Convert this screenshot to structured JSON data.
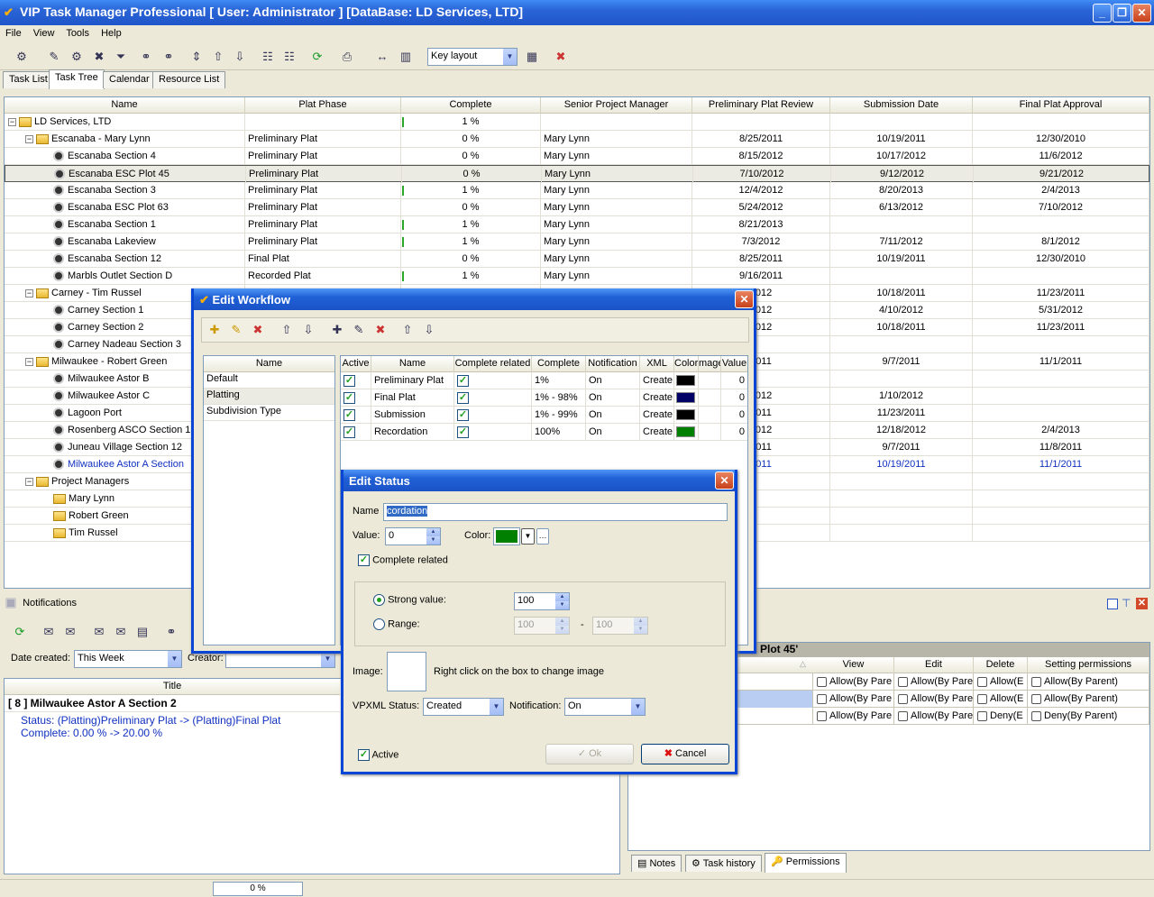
{
  "window": {
    "title": "VIP Task Manager Professional [ User: Administrator ] [DataBase: LD Services, LTD]"
  },
  "menu": [
    "File",
    "View",
    "Tools",
    "Help"
  ],
  "toolbar": {
    "layout_combo": "Key layout"
  },
  "tabs": [
    "Task List",
    "Task Tree",
    "Calendar",
    "Resource List"
  ],
  "grid": {
    "headers": [
      "Name",
      "Plat Phase",
      "Complete",
      "Senior Project Manager",
      "Preliminary Plat Review",
      "Submission Date",
      "Final Plat Approval"
    ],
    "rows": [
      {
        "name": "LD Services, LTD",
        "phase": "",
        "complete": "1 %",
        "manager": "",
        "review": "",
        "submission": "",
        "approval": ""
      },
      {
        "name": "Escanaba - Mary Lynn",
        "phase": "Preliminary Plat",
        "complete": "0 %",
        "manager": "Mary Lynn",
        "review": "8/25/2011",
        "submission": "10/19/2011",
        "approval": "12/30/2010"
      },
      {
        "name": "Escanaba Section 4",
        "phase": "Preliminary Plat",
        "complete": "0 %",
        "manager": "Mary Lynn",
        "review": "8/15/2012",
        "submission": "10/17/2012",
        "approval": "11/6/2012"
      },
      {
        "name": "Escanaba ESC Plot 45",
        "phase": "Preliminary Plat",
        "complete": "0 %",
        "manager": "Mary Lynn",
        "review": "7/10/2012",
        "submission": "9/12/2012",
        "approval": "9/21/2012"
      },
      {
        "name": "Escanaba Section 3",
        "phase": "Preliminary Plat",
        "complete": "1 %",
        "manager": "Mary Lynn",
        "review": "12/4/2012",
        "submission": "8/20/2013",
        "approval": "2/4/2013"
      },
      {
        "name": "Escanaba ESC Plot 63",
        "phase": "Preliminary Plat",
        "complete": "0 %",
        "manager": "Mary Lynn",
        "review": "5/24/2012",
        "submission": "6/13/2012",
        "approval": "7/10/2012"
      },
      {
        "name": "Escanaba Section 1",
        "phase": "Preliminary Plat",
        "complete": "1 %",
        "manager": "Mary Lynn",
        "review": "8/21/2013",
        "submission": "",
        "approval": ""
      },
      {
        "name": "Escanaba Lakeview",
        "phase": "Preliminary Plat",
        "complete": "1 %",
        "manager": "Mary Lynn",
        "review": "7/3/2012",
        "submission": "7/11/2012",
        "approval": "8/1/2012"
      },
      {
        "name": "Escanaba Section 12",
        "phase": "Final Plat",
        "complete": "0 %",
        "manager": "Mary Lynn",
        "review": "8/25/2011",
        "submission": "10/19/2011",
        "approval": "12/30/2010"
      },
      {
        "name": "Marbls Outlet Section D",
        "phase": "Recorded Plat",
        "complete": "1 %",
        "manager": "Mary Lynn",
        "review": "9/16/2011",
        "submission": "",
        "approval": ""
      },
      {
        "name": "Carney - Tim Russel",
        "phase": "",
        "complete": "",
        "manager": "",
        "review": "2012",
        "submission": "10/18/2011",
        "approval": "11/23/2011"
      },
      {
        "name": "Carney Section 1",
        "phase": "",
        "complete": "",
        "manager": "",
        "review": "2012",
        "submission": "4/10/2012",
        "approval": "5/31/2012"
      },
      {
        "name": "Carney Section 2",
        "phase": "",
        "complete": "",
        "manager": "",
        "review": "2012",
        "submission": "10/18/2011",
        "approval": "11/23/2011"
      },
      {
        "name": "Carney Nadeau Section 3",
        "phase": "",
        "complete": "",
        "manager": "",
        "review": "",
        "submission": "",
        "approval": ""
      },
      {
        "name": "Milwaukee - Robert Green",
        "phase": "",
        "complete": "",
        "manager": "",
        "review": "2011",
        "submission": "9/7/2011",
        "approval": "11/1/2011"
      },
      {
        "name": "Milwaukee Astor B",
        "phase": "",
        "complete": "",
        "manager": "",
        "review": "",
        "submission": "",
        "approval": ""
      },
      {
        "name": "Milwaukee Astor C",
        "phase": "",
        "complete": "",
        "manager": "",
        "review": "2012",
        "submission": "1/10/2012",
        "approval": ""
      },
      {
        "name": "Lagoon Port",
        "phase": "",
        "complete": "",
        "manager": "",
        "review": "2011",
        "submission": "11/23/2011",
        "approval": ""
      },
      {
        "name": "Rosenberg ASCO Section 1",
        "phase": "",
        "complete": "",
        "manager": "",
        "review": "2012",
        "submission": "12/18/2012",
        "approval": "2/4/2013"
      },
      {
        "name": "Juneau Village Section 12",
        "phase": "",
        "complete": "",
        "manager": "",
        "review": "2011",
        "submission": "9/7/2011",
        "approval": "11/8/2011"
      },
      {
        "name": "Milwaukee  Astor A Section",
        "phase": "",
        "complete": "",
        "manager": "",
        "review": "2011",
        "submission": "10/19/2011",
        "approval": "11/1/2011"
      },
      {
        "name": "Project Managers",
        "phase": "",
        "complete": "",
        "manager": "",
        "review": "",
        "submission": "",
        "approval": ""
      },
      {
        "name": "Mary Lynn",
        "phase": "",
        "complete": "",
        "manager": "",
        "review": "",
        "submission": "",
        "approval": ""
      },
      {
        "name": "Robert Green",
        "phase": "",
        "complete": "",
        "manager": "",
        "review": "",
        "submission": "",
        "approval": ""
      },
      {
        "name": "Tim Russel",
        "phase": "",
        "complete": "",
        "manager": "",
        "review": "",
        "submission": "",
        "approval": ""
      }
    ]
  },
  "notifications": {
    "title": "Notifications",
    "date_label": "Date created:",
    "date_value": "This Week",
    "creator_label": "Creator:",
    "col_title": "Title",
    "item_title": "[ 8 ] Milwaukee  Astor A Section 2",
    "item_line1": "Status: (Platting)Preliminary Plat -> (Platting)Final Plat",
    "item_line2": "Complete: 0.00 % -> 20.00 %"
  },
  "permissions": {
    "task_label": "Plot 45'",
    "headers": [
      "View",
      "Edit",
      "Delete",
      "Setting permissions"
    ],
    "rows": [
      [
        "Allow(By Pare",
        "Allow(By Pare",
        "Allow(E",
        "Allow(By Parent)"
      ],
      [
        "Allow(By Pare",
        "Allow(By Pare",
        "Allow(E",
        "Allow(By Parent)"
      ],
      [
        "Allow(By Pare",
        "Allow(By Pare",
        "Deny(E",
        "Deny(By Parent)"
      ]
    ],
    "tabs": [
      "Notes",
      "Task history",
      "Permissions"
    ]
  },
  "workflow_dialog": {
    "title": "Edit Workflow",
    "list_header": "Name",
    "list_items": [
      "Default",
      "Platting",
      "Subdivision Type"
    ],
    "headers": [
      "Active",
      "Name",
      "Complete related",
      "Complete",
      "Notification",
      "XML sta",
      "Color",
      "mage",
      "Value"
    ],
    "rows": [
      {
        "name": "Preliminary Plat",
        "complete": "1%",
        "notification": "On",
        "xml": "Create",
        "value": "0",
        "color": "#000000"
      },
      {
        "name": "Final Plat",
        "complete": "1% - 98%",
        "notification": "On",
        "xml": "Create",
        "value": "0",
        "color": "#000066"
      },
      {
        "name": "Submission",
        "complete": "1% - 99%",
        "notification": "On",
        "xml": "Create",
        "value": "0",
        "color": "#000000"
      },
      {
        "name": "Recordation",
        "complete": "100%",
        "notification": "On",
        "xml": "Create",
        "value": "0",
        "color": "#008000"
      }
    ]
  },
  "status_dialog": {
    "title": "Edit Status",
    "name_label": "Name",
    "name_value": "cordation",
    "value_label": "Value:",
    "value_value": "0",
    "color_label": "Color:",
    "color_value": "#008000",
    "complete_related_label": "Complete related",
    "strong_value_label": "Strong value:",
    "strong_value": "100",
    "range_label": "Range:",
    "range_from": "100",
    "range_sep": "-",
    "range_to": "100",
    "image_label": "Image:",
    "image_hint": "Right click on the box to  change image",
    "vpxml_label": "VPXML Status:",
    "vpxml_value": "Created",
    "notification_label": "Notification:",
    "notification_value": "On",
    "active_label": "Active",
    "ok_label": "Ok",
    "cancel_label": "Cancel"
  },
  "statusbar": {
    "progress": "0 %"
  }
}
